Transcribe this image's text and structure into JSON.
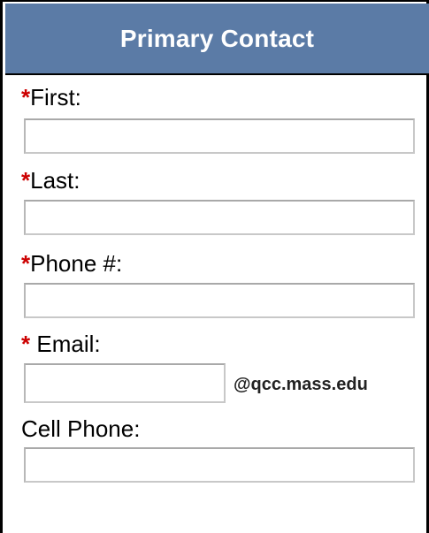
{
  "form": {
    "title": "Primary Contact",
    "required_marker": "*",
    "first": {
      "label": "First:",
      "value": "",
      "placeholder": ""
    },
    "last": {
      "label": "Last:",
      "value": "",
      "placeholder": ""
    },
    "phone": {
      "label": "Phone #:",
      "value": "",
      "placeholder": ""
    },
    "email": {
      "label": "Email:",
      "value": "",
      "placeholder": "",
      "domain_suffix": "@qcc.mass.edu"
    },
    "cell_phone": {
      "label": "Cell Phone:",
      "value": "",
      "placeholder": ""
    }
  },
  "colors": {
    "header_background": "#5b7ba6",
    "header_text": "#ffffff",
    "required_marker": "#cc0000"
  }
}
